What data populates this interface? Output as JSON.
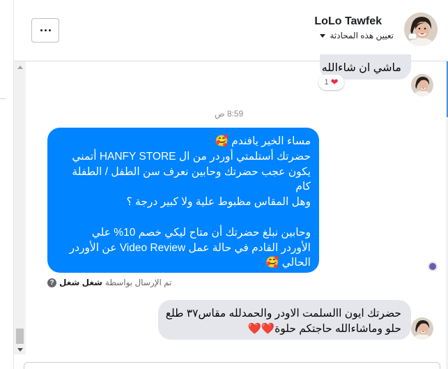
{
  "header": {
    "contact_name": "LoLo Tawfek",
    "assign_label": "تعيين هذه المحادثة"
  },
  "messages": {
    "top_incoming": {
      "text": "ماشي  ان شاءالله",
      "reaction_emoji": "❤",
      "reaction_count": "1"
    },
    "timestamp": "8:59 ص",
    "outgoing": {
      "lines": [
        "مساء الخير يافندم 🥰",
        "حضرتك أستلمتي أوردر من ال HANFY STORE أتمني",
        "يكون عجب حضرتك وحابين نعرف سن الطفل / الطفلة",
        "كام",
        "وهل المقاس مظبوط علية ولا كبير درجة ؟",
        "",
        "وحابين نبلغ حضرتك أن متاح ليكي خصم 10% علي",
        "الأوردر القادم في حالة عمل Video Review عن الأوردر",
        "الحالي 🥰"
      ]
    },
    "sent_by": {
      "label": "تم الإرسال بواسطة",
      "agent": "شغل شغل",
      "help_icon": "?"
    },
    "bottom_incoming": {
      "lines": [
        "حضرتك ايون االسلمت الاودر والحمدلله مقاس٣٧ طلع",
        "حلو وماشاءالله  حاجتكم حلوة❤️❤️"
      ]
    }
  },
  "colors": {
    "outgoing_bubble": "#0084ff",
    "incoming_bubble": "#e4e6eb",
    "reaction_heart": "#f02849"
  }
}
